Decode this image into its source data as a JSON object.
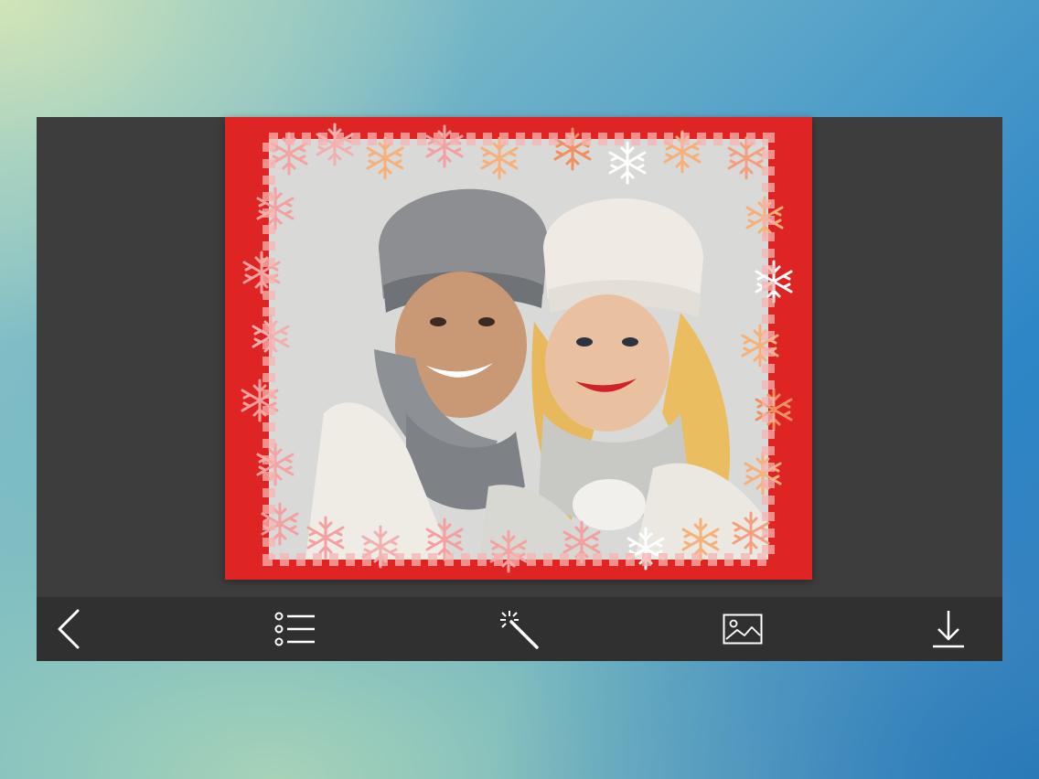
{
  "editor": {
    "frame_name": "winter-snowflake-frame",
    "frame_color": "#df2424",
    "snowflake_colors": [
      "#f2a0a0",
      "#f6b07a",
      "#ffffff",
      "#ee8c66"
    ],
    "canvas_background": "#3d3d3d"
  },
  "toolbar": {
    "background": "#303030",
    "icon_color": "#ffffff",
    "items": [
      {
        "name": "back-button",
        "icon": "chevron-left-icon"
      },
      {
        "name": "frames-list-button",
        "icon": "list-icon"
      },
      {
        "name": "effects-button",
        "icon": "magic-wand-icon"
      },
      {
        "name": "gallery-button",
        "icon": "image-icon"
      },
      {
        "name": "download-button",
        "icon": "download-icon"
      }
    ]
  }
}
